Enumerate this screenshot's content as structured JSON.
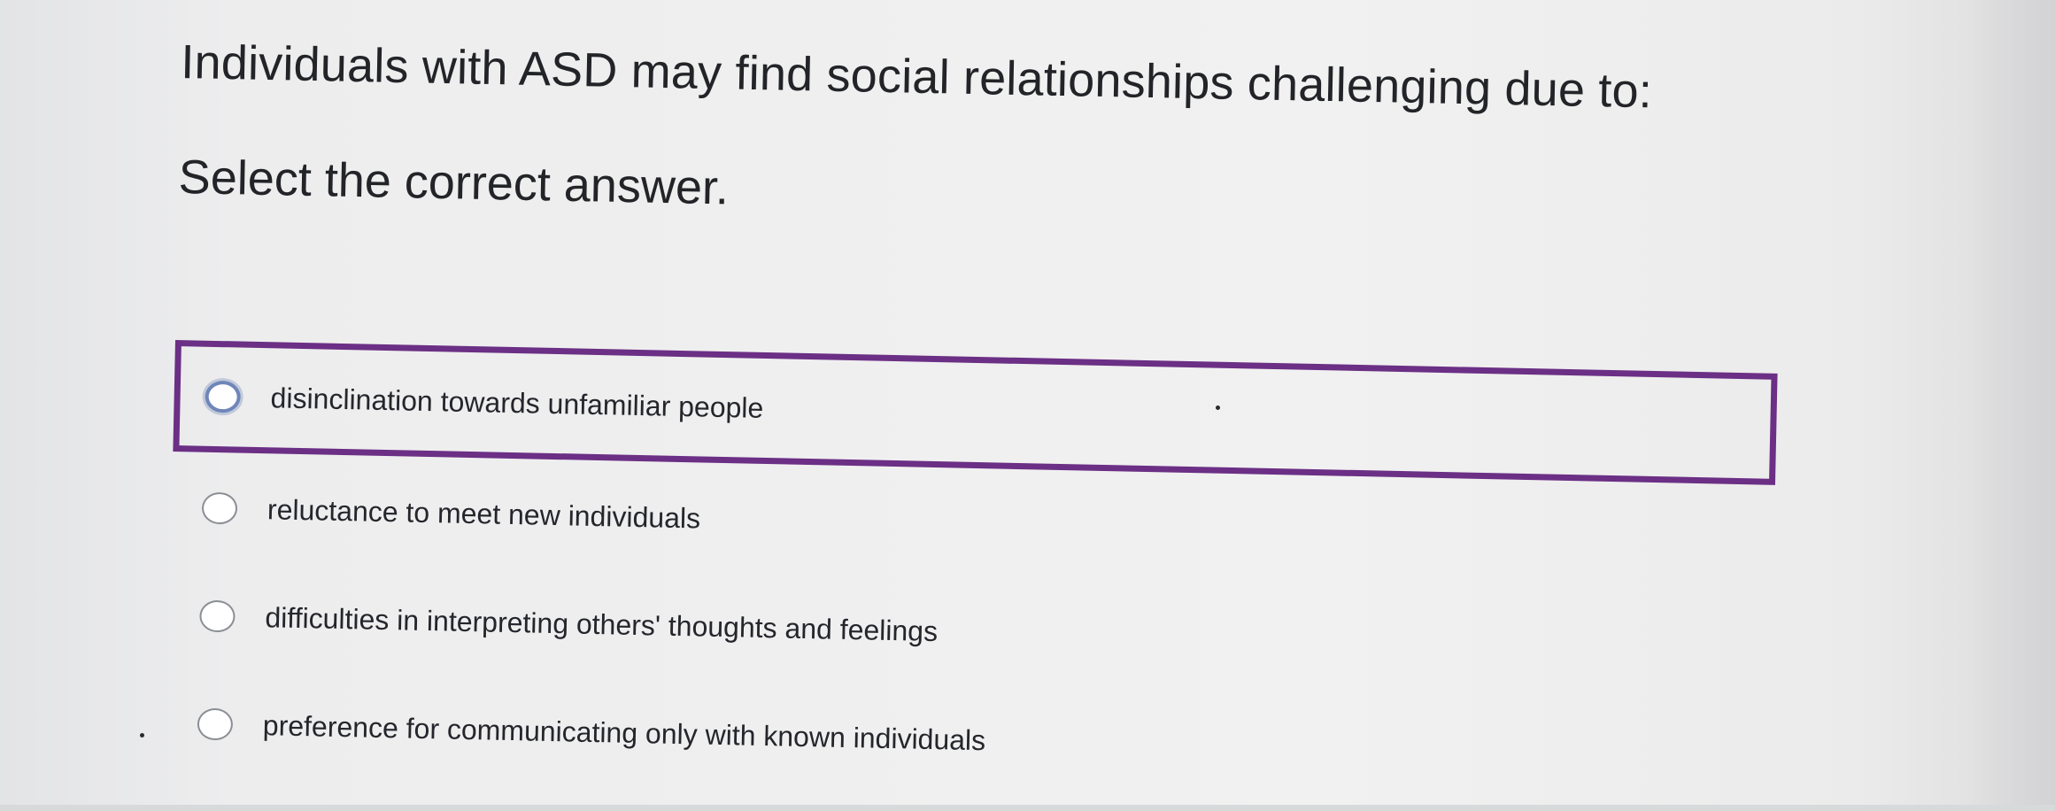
{
  "question": {
    "text": "Individuals with ASD may find social relationships challenging due to:",
    "instruction": "Select the correct answer."
  },
  "options": [
    {
      "label": "disinclination towards unfamiliar people",
      "selected": true
    },
    {
      "label": "reluctance to meet new individuals",
      "selected": false
    },
    {
      "label": "difficulties in interpreting others' thoughts and feelings",
      "selected": false
    },
    {
      "label": "preference for communicating only with known individuals",
      "selected": false
    }
  ],
  "colors": {
    "selection_border": "#6b2f85",
    "selected_radio": "#6f86b8",
    "radio_border": "#8b8e94",
    "text": "#222428"
  }
}
